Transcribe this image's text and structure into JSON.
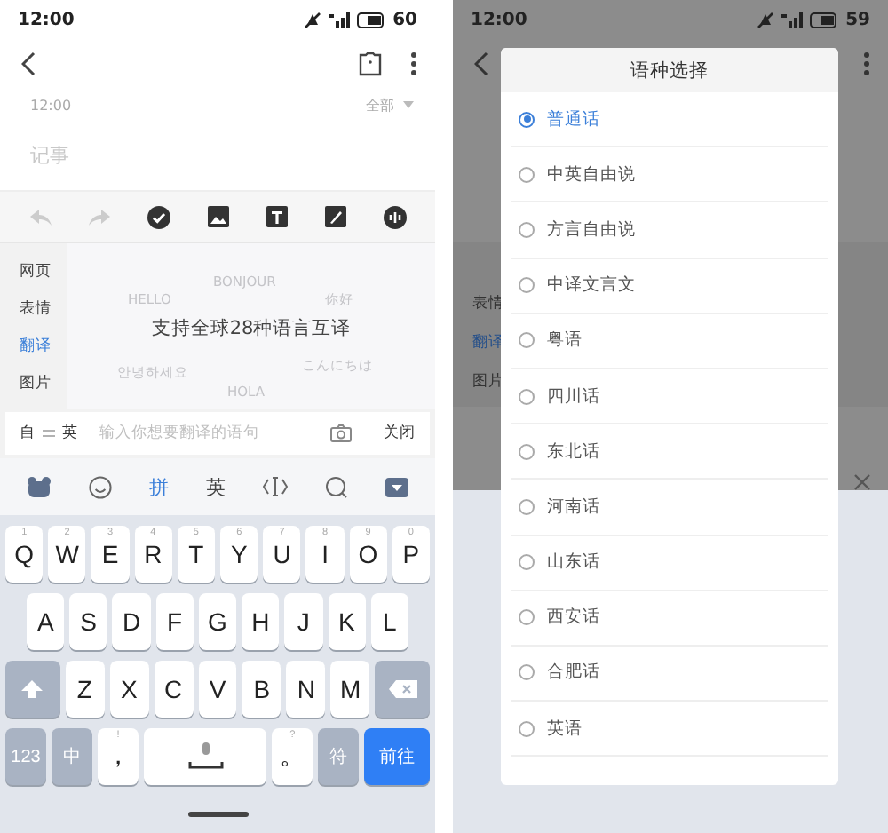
{
  "left": {
    "status_bar": {
      "time": "12:00",
      "battery": "60"
    },
    "note": {
      "time": "12:00",
      "filter": "全部",
      "placeholder": "记事"
    },
    "panel": {
      "tabs": [
        {
          "label": "网页",
          "selected": false
        },
        {
          "label": "表情",
          "selected": false
        },
        {
          "label": "翻译",
          "selected": true
        },
        {
          "label": "图片",
          "selected": false
        }
      ],
      "headline": "支持全球28种语言互译",
      "floating_words": [
        "BONJOUR",
        "HELLO",
        "你好",
        "안녕하세요",
        "こんにちは",
        "HOLA"
      ]
    },
    "translate_bar": {
      "from": "自",
      "to": "英",
      "placeholder": "输入你想要翻译的语句",
      "close": "关闭"
    },
    "keyboard": {
      "modes": [
        {
          "label": "拼",
          "selected": true
        },
        {
          "label": "英",
          "selected": false
        }
      ],
      "rows": [
        {
          "keys": [
            {
              "kind": "letter",
              "label": "Q",
              "hint": "1"
            },
            {
              "kind": "letter",
              "label": "W",
              "hint": "2"
            },
            {
              "kind": "letter",
              "label": "E",
              "hint": "3"
            },
            {
              "kind": "letter",
              "label": "R",
              "hint": "4"
            },
            {
              "kind": "letter",
              "label": "T",
              "hint": "5"
            },
            {
              "kind": "letter",
              "label": "Y",
              "hint": "6"
            },
            {
              "kind": "letter",
              "label": "U",
              "hint": "7"
            },
            {
              "kind": "letter",
              "label": "I",
              "hint": "8"
            },
            {
              "kind": "letter",
              "label": "O",
              "hint": "9"
            },
            {
              "kind": "letter",
              "label": "P",
              "hint": "0"
            }
          ]
        },
        {
          "keys": [
            {
              "kind": "letter",
              "label": "A"
            },
            {
              "kind": "letter",
              "label": "S"
            },
            {
              "kind": "letter",
              "label": "D"
            },
            {
              "kind": "letter",
              "label": "F"
            },
            {
              "kind": "letter",
              "label": "G"
            },
            {
              "kind": "letter",
              "label": "H"
            },
            {
              "kind": "letter",
              "label": "J"
            },
            {
              "kind": "letter",
              "label": "K"
            },
            {
              "kind": "letter",
              "label": "L"
            }
          ]
        },
        {
          "keys": [
            {
              "kind": "shift"
            },
            {
              "kind": "letter",
              "label": "Z"
            },
            {
              "kind": "letter",
              "label": "X"
            },
            {
              "kind": "letter",
              "label": "C"
            },
            {
              "kind": "letter",
              "label": "V"
            },
            {
              "kind": "letter",
              "label": "B"
            },
            {
              "kind": "letter",
              "label": "N"
            },
            {
              "kind": "letter",
              "label": "M"
            },
            {
              "kind": "backspace"
            }
          ]
        },
        {
          "keys": [
            {
              "kind": "function",
              "label": "123"
            },
            {
              "kind": "function",
              "label": "中"
            },
            {
              "kind": "letter",
              "label": "，",
              "hint": "!"
            },
            {
              "kind": "space"
            },
            {
              "kind": "letter",
              "label": "。",
              "hint": "?"
            },
            {
              "kind": "function",
              "label": "符"
            },
            {
              "kind": "enter",
              "label": "前往"
            }
          ]
        }
      ]
    }
  },
  "right": {
    "status_bar": {
      "time": "12:00",
      "battery": "59"
    },
    "background_tabs": [
      {
        "label": "表情",
        "selected": false
      },
      {
        "label": "翻译",
        "selected": true
      },
      {
        "label": "图片",
        "selected": false
      }
    ],
    "dialog": {
      "title": "语种选择",
      "options": [
        {
          "label": "普通话",
          "selected": true
        },
        {
          "label": "中英自由说",
          "selected": false
        },
        {
          "label": "方言自由说",
          "selected": false
        },
        {
          "label": "中译文言文",
          "selected": false
        },
        {
          "label": "粤语",
          "selected": false
        },
        {
          "label": "四川话",
          "selected": false
        },
        {
          "label": "东北话",
          "selected": false
        },
        {
          "label": "河南话",
          "selected": false
        },
        {
          "label": "山东话",
          "selected": false
        },
        {
          "label": "西安话",
          "selected": false
        },
        {
          "label": "合肥话",
          "selected": false
        },
        {
          "label": "英语",
          "selected": false
        }
      ]
    }
  }
}
